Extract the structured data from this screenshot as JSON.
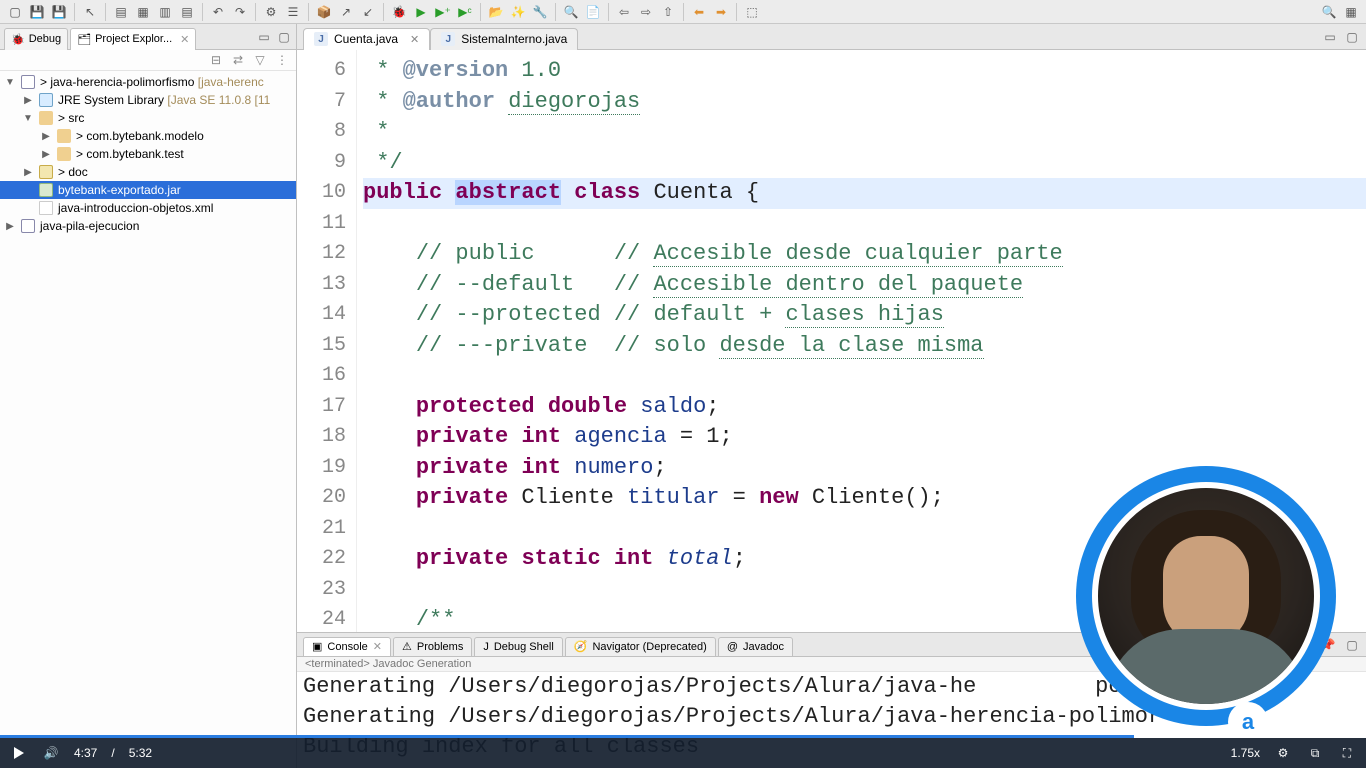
{
  "toolbar": {
    "icons": [
      "new",
      "save",
      "save-all",
      "print",
      "build",
      "sep",
      "undo",
      "redo",
      "sep",
      "cut",
      "copy",
      "paste",
      "sep",
      "format",
      "sep",
      "bug",
      "run",
      "run-ext",
      "profile",
      "sep",
      "open-type",
      "open-task",
      "search",
      "sep",
      "tool1",
      "tool2",
      "tool3",
      "sep",
      "back",
      "forward",
      "sep",
      "perspective"
    ],
    "rightIcons": [
      "search",
      "perspective-switch"
    ]
  },
  "leftPanel": {
    "tabs": {
      "debug": "Debug",
      "projectExplorer": "Project Explor..."
    },
    "tree": [
      {
        "depth": 0,
        "expanded": true,
        "kind": "project",
        "label": "java-herencia-polimorfismo",
        "deco": " [java-herenc",
        "prefix": "> ",
        "sel": false
      },
      {
        "depth": 1,
        "expanded": false,
        "kind": "lib",
        "label": "JRE System Library",
        "deco": " [Java SE 11.0.8 [11",
        "sel": false
      },
      {
        "depth": 1,
        "expanded": true,
        "kind": "srcfolder",
        "label": "src",
        "prefix": "> ",
        "sel": false
      },
      {
        "depth": 2,
        "expanded": false,
        "kind": "package",
        "label": "com.bytebank.modelo",
        "prefix": "> ",
        "sel": false
      },
      {
        "depth": 2,
        "expanded": false,
        "kind": "package",
        "label": "com.bytebank.test",
        "prefix": "> ",
        "sel": false
      },
      {
        "depth": 1,
        "expanded": false,
        "kind": "folder",
        "label": "doc",
        "prefix": "> ",
        "sel": false
      },
      {
        "depth": 1,
        "expanded": false,
        "kind": "jar",
        "label": "bytebank-exportado.jar",
        "sel": true
      },
      {
        "depth": 1,
        "expanded": false,
        "kind": "xml",
        "label": "java-introduccion-objetos.xml",
        "sel": false
      },
      {
        "depth": 0,
        "expanded": false,
        "kind": "project",
        "label": "java-pila-ejecucion",
        "sel": false
      }
    ]
  },
  "editor": {
    "tabs": [
      {
        "label": "Cuenta.java",
        "active": true
      },
      {
        "label": "SistemaInterno.java",
        "active": false
      }
    ],
    "linesStart": 6,
    "lines": [
      {
        "tokens": [
          {
            "t": " * ",
            "c": "cm"
          },
          {
            "t": "@version",
            "c": "tag"
          },
          {
            "t": " 1.0",
            "c": "cm"
          }
        ]
      },
      {
        "tokens": [
          {
            "t": " * ",
            "c": "cm"
          },
          {
            "t": "@author",
            "c": "tag"
          },
          {
            "t": " ",
            "c": "cm"
          },
          {
            "t": "diegorojas",
            "c": "cm-u"
          }
        ]
      },
      {
        "tokens": [
          {
            "t": " *",
            "c": "cm"
          }
        ]
      },
      {
        "tokens": [
          {
            "t": " */",
            "c": "cm"
          }
        ]
      },
      {
        "hl": true,
        "tokens": [
          {
            "t": "public",
            "c": "kw"
          },
          {
            "t": " ",
            "c": "type"
          },
          {
            "t": "abstract",
            "c": "kw-sel"
          },
          {
            "t": " ",
            "c": "type"
          },
          {
            "t": "class",
            "c": "kw"
          },
          {
            "t": " Cuenta {",
            "c": "type"
          }
        ]
      },
      {
        "tokens": []
      },
      {
        "tokens": [
          {
            "t": "    ",
            "c": "type"
          },
          {
            "t": "// public      // ",
            "c": "cm"
          },
          {
            "t": "Accesible desde cualquier parte",
            "c": "cm-u"
          }
        ]
      },
      {
        "tokens": [
          {
            "t": "    ",
            "c": "type"
          },
          {
            "t": "// --default   // ",
            "c": "cm"
          },
          {
            "t": "Accesible dentro del paquete",
            "c": "cm-u"
          }
        ]
      },
      {
        "tokens": [
          {
            "t": "    ",
            "c": "type"
          },
          {
            "t": "// --protected // default + ",
            "c": "cm"
          },
          {
            "t": "clases hijas",
            "c": "cm-u"
          }
        ]
      },
      {
        "tokens": [
          {
            "t": "    ",
            "c": "type"
          },
          {
            "t": "// ---private  // solo ",
            "c": "cm"
          },
          {
            "t": "desde la clase misma",
            "c": "cm-u"
          }
        ]
      },
      {
        "tokens": []
      },
      {
        "tokens": [
          {
            "t": "    ",
            "c": "type"
          },
          {
            "t": "protected",
            "c": "kw"
          },
          {
            "t": " ",
            "c": "type"
          },
          {
            "t": "double",
            "c": "kw"
          },
          {
            "t": " ",
            "c": "type"
          },
          {
            "t": "saldo",
            "c": "id"
          },
          {
            "t": ";",
            "c": "type"
          }
        ]
      },
      {
        "tokens": [
          {
            "t": "    ",
            "c": "type"
          },
          {
            "t": "private",
            "c": "kw"
          },
          {
            "t": " ",
            "c": "type"
          },
          {
            "t": "int",
            "c": "kw"
          },
          {
            "t": " ",
            "c": "type"
          },
          {
            "t": "agencia",
            "c": "id"
          },
          {
            "t": " = 1;",
            "c": "type"
          }
        ]
      },
      {
        "tokens": [
          {
            "t": "    ",
            "c": "type"
          },
          {
            "t": "private",
            "c": "kw"
          },
          {
            "t": " ",
            "c": "type"
          },
          {
            "t": "int",
            "c": "kw"
          },
          {
            "t": " ",
            "c": "type"
          },
          {
            "t": "numero",
            "c": "id"
          },
          {
            "t": ";",
            "c": "type"
          }
        ]
      },
      {
        "tokens": [
          {
            "t": "    ",
            "c": "type"
          },
          {
            "t": "private",
            "c": "kw"
          },
          {
            "t": " Cliente ",
            "c": "type"
          },
          {
            "t": "titular",
            "c": "id"
          },
          {
            "t": " = ",
            "c": "type"
          },
          {
            "t": "new",
            "c": "kw"
          },
          {
            "t": " Cliente();",
            "c": "type"
          }
        ]
      },
      {
        "tokens": []
      },
      {
        "tokens": [
          {
            "t": "    ",
            "c": "type"
          },
          {
            "t": "private",
            "c": "kw"
          },
          {
            "t": " ",
            "c": "type"
          },
          {
            "t": "static",
            "c": "kw"
          },
          {
            "t": " ",
            "c": "type"
          },
          {
            "t": "int",
            "c": "kw"
          },
          {
            "t": " ",
            "c": "type"
          },
          {
            "t": "total",
            "c": "id-i"
          },
          {
            "t": ";",
            "c": "type"
          }
        ]
      },
      {
        "tokens": []
      },
      {
        "tokens": [
          {
            "t": "    ",
            "c": "type"
          },
          {
            "t": "/**",
            "c": "cm"
          }
        ]
      }
    ]
  },
  "bottom": {
    "tabs": [
      {
        "label": "Console",
        "active": true,
        "icon": "console"
      },
      {
        "label": "Problems",
        "active": false,
        "icon": "problems"
      },
      {
        "label": "Debug Shell",
        "active": false,
        "icon": "debug-shell"
      },
      {
        "label": "Navigator (Deprecated)",
        "active": false,
        "icon": "navigator"
      },
      {
        "label": "Javadoc",
        "active": false,
        "icon": "javadoc"
      }
    ],
    "subtitle": "<terminated> Javadoc Generation",
    "lines": [
      "Generating /Users/diegorojas/Projects/Alura/java-he         polimor",
      "Generating /Users/diegorojas/Projects/Alura/java-herencia-polimor",
      "Building index for all classes"
    ]
  },
  "video": {
    "current": "4:37",
    "total": "5:32",
    "progressPct": 83,
    "speed": "1.75x"
  },
  "badge": "a"
}
